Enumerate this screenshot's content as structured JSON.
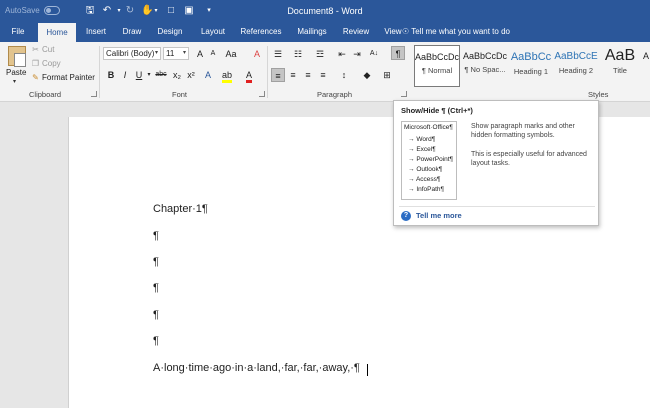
{
  "titlebar": {
    "autosave": "AutoSave",
    "doc_title": "Document8  -  Word",
    "qat_icons": [
      "save-icon",
      "undo-icon",
      "redo-icon",
      "touch-mode-icon",
      "new-document-icon",
      "open-icon",
      "customize-icon"
    ]
  },
  "tabs": [
    "File",
    "Home",
    "Insert",
    "Draw",
    "Design",
    "Layout",
    "References",
    "Mailings",
    "Review",
    "View"
  ],
  "tell_me": "Tell me what you want to do",
  "clipboard": {
    "paste": "Paste",
    "cut": "Cut",
    "copy": "Copy",
    "format_painter": "Format Painter",
    "label": "Clipboard"
  },
  "font": {
    "family": "Calibri (Body)",
    "size": "11",
    "label": "Font",
    "bold": "B",
    "italic": "I",
    "underline": "U",
    "strike": "abc",
    "subscript": "x₂",
    "superscript": "x²",
    "grow": "A",
    "change_case": "Aa",
    "clear": "A",
    "effects": "A",
    "highlight": "ab",
    "color": "A"
  },
  "paragraph": {
    "label": "Paragraph",
    "show_hide": "¶"
  },
  "styles": {
    "label": "Styles",
    "items": [
      {
        "preview": "AaBbCcDc",
        "name": "¶ Normal"
      },
      {
        "preview": "AaBbCcDc",
        "name": "¶ No Spac..."
      },
      {
        "preview": "AaBbCc",
        "name": "Heading 1"
      },
      {
        "preview": "AaBbCcE",
        "name": "Heading 2"
      },
      {
        "preview": "AaB",
        "name": "Title"
      },
      {
        "preview": "A",
        "name": ""
      }
    ]
  },
  "document": {
    "paragraphs": [
      "Chapter·1¶",
      "¶",
      "¶",
      "¶",
      "¶",
      "¶",
      "A·long·time·ago·in·a·land,·far,·far,·away,·¶"
    ]
  },
  "tooltip": {
    "title": "Show/Hide ¶ (Ctrl+*)",
    "illus_head": "Microsoft·Office¶",
    "illus_items": [
      "Word¶",
      "Excel¶",
      "PowerPoint¶",
      "Outlook¶",
      "Access¶",
      "InfoPath¶"
    ],
    "desc1": "Show paragraph marks and other hidden formatting symbols.",
    "desc2": "This is especially useful for advanced layout tasks.",
    "more": "Tell me more"
  },
  "colors": {
    "brand": "#2b579a",
    "ribbon_bg": "#f3f3f3",
    "highlight_yellow": "#ffff00",
    "font_red": "#e02020",
    "help_blue": "#2b6cc4"
  }
}
